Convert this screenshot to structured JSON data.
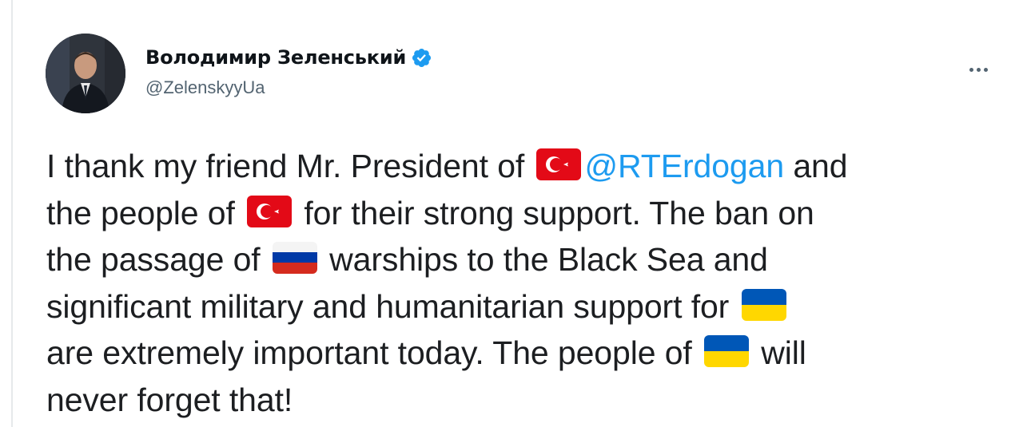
{
  "author": {
    "display_name": "Володимир Зеленський",
    "handle": "@ZelenskyyUa",
    "verified": true
  },
  "menu": {
    "more_icon": "more-horizontal-icon"
  },
  "tweet": {
    "segments": {
      "s1": "I thank my friend Mr. President of ",
      "flag_tr_1": "turkey-flag-emoji",
      "mention": "@RTErdogan",
      "s2": " and",
      "s3": "the people of ",
      "flag_tr_2": "turkey-flag-emoji",
      "s4": " for their strong support. The ban on",
      "s5": "the passage of ",
      "flag_ru": "russia-flag-emoji",
      "s6": " warships to the Black Sea and",
      "s7": "significant military and humanitarian support for ",
      "flag_ua_1": "ukraine-flag-emoji",
      "s8": "are extremely important today. The people of ",
      "flag_ua_2": "ukraine-flag-emoji",
      "s9": " will",
      "s10": "never forget that!"
    }
  },
  "colors": {
    "mention": "#1d9bf0",
    "verified_badge": "#1d9bf0",
    "handle": "#536471",
    "text": "#1c1e21",
    "turkey_red": "#e30a17",
    "ukraine_blue": "#0057b7",
    "ukraine_yellow": "#ffd700",
    "russia_blue": "#0039a6",
    "russia_red": "#d52b1e"
  }
}
